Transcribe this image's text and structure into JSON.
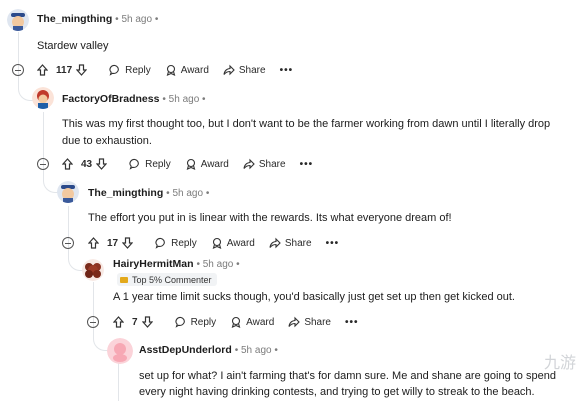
{
  "comments": [
    {
      "author": "The_mingthing",
      "time": "5h ago",
      "text": "Stardew valley",
      "score": "117",
      "reply_label": "Reply",
      "award_label": "Award",
      "share_label": "Share"
    },
    {
      "author": "FactoryOfBradness",
      "time": "5h ago",
      "text_line1": "This was my first thought too, but I don't want to be the farmer working from dawn until I literally drop",
      "text_line2": "due to exhaustion.",
      "score": "43",
      "reply_label": "Reply",
      "award_label": "Award",
      "share_label": "Share"
    },
    {
      "author": "The_mingthing",
      "time": "5h ago",
      "text": "The effort you put in is linear with the rewards. Its what everyone dream of!",
      "score": "17",
      "reply_label": "Reply",
      "award_label": "Award",
      "share_label": "Share"
    },
    {
      "author": "HairyHermitMan",
      "time": "5h ago",
      "badge": "Top 5% Commenter",
      "text": "A 1 year time limit sucks though, you'd basically just get set up then get kicked out.",
      "score": "7",
      "reply_label": "Reply",
      "award_label": "Award",
      "share_label": "Share"
    },
    {
      "author": "AsstDepUnderlord",
      "time": "5h ago",
      "text_line1": "set up for what? I ain't farming that's for damn sure. Me and shane are going to spend",
      "text_line2": "every night having drinking contests, and trying to get willy to streak to the beach."
    }
  ],
  "separator": "•",
  "more_label": "•••",
  "watermark": "九游"
}
